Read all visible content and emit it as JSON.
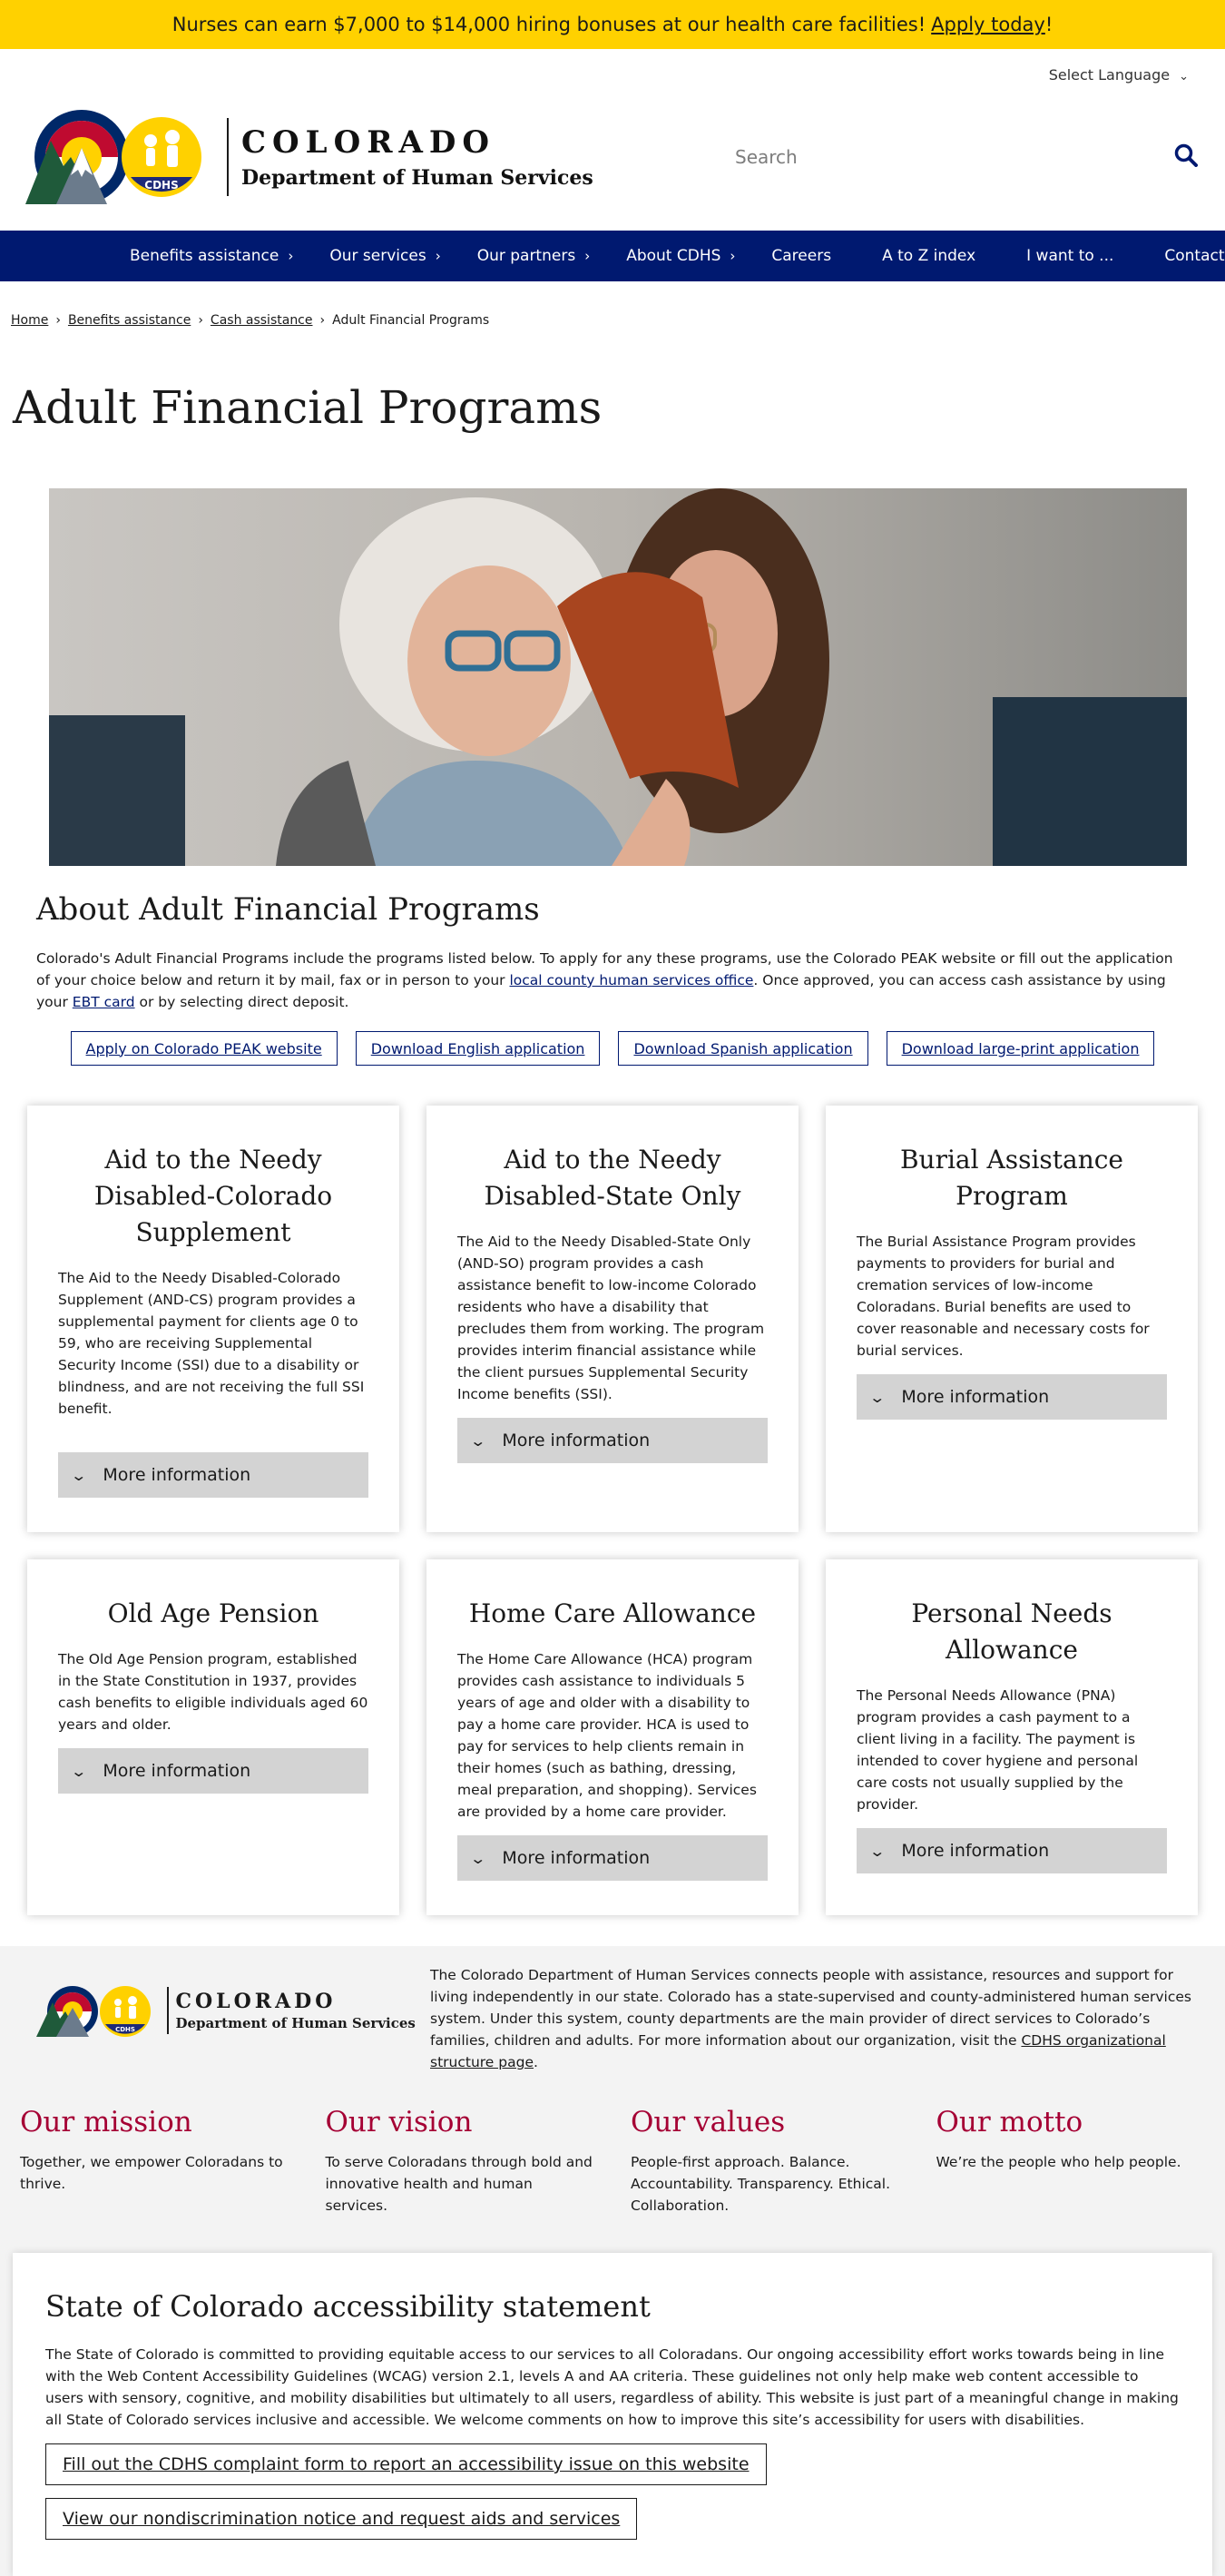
{
  "alert": {
    "text": "Nurses can earn $7,000 to $14,000 hiring bonuses at our health care facilities!",
    "link": "Apply today",
    "tail": "!"
  },
  "header": {
    "language": "Select Language",
    "logo_title": "COLORADO",
    "logo_subtitle": "Department of Human Services",
    "logo_badge": "CDHS",
    "search_placeholder": "Search"
  },
  "nav": {
    "items": [
      {
        "label": "Benefits assistance",
        "has_submenu": true
      },
      {
        "label": "Our services",
        "has_submenu": true
      },
      {
        "label": "Our partners",
        "has_submenu": true
      },
      {
        "label": "About CDHS",
        "has_submenu": true
      },
      {
        "label": "Careers",
        "has_submenu": false
      },
      {
        "label": "A to Z index",
        "has_submenu": false
      },
      {
        "label": "I want to ...",
        "has_submenu": false
      },
      {
        "label": "Contact us",
        "has_submenu": false
      }
    ]
  },
  "breadcrumb": {
    "home": "Home",
    "benefits": "Benefits assistance",
    "cash": "Cash assistance",
    "current": "Adult Financial Programs"
  },
  "page_title": "Adult Financial Programs",
  "about": {
    "heading": "About Adult Financial Programs",
    "text_1": "Colorado's Adult Financial Programs include the programs listed below. To apply for any these programs, use the Colorado PEAK website or fill out the application of your choice below and return it by mail, fax or in person to your ",
    "link_1": "local county human services office",
    "text_2": ". Once approved, you can access cash assistance by using your ",
    "link_2": "EBT card",
    "text_3": " or by selecting direct deposit.",
    "buttons": [
      "Apply on Colorado PEAK website",
      "Download English application",
      "Download Spanish application",
      "Download large-print application"
    ]
  },
  "cards": [
    {
      "title": "Aid to the Needy Disabled-Colorado Supplement",
      "body": "The Aid to the Needy Disabled-Colorado Supplement (AND-CS) program provides a supplemental payment for clients age 0 to 59, who are receiving Supplemental Security Income (SSI) due to a disability or blindness, and are not receiving the full SSI benefit.",
      "more": "More information"
    },
    {
      "title": "Aid to the Needy Disabled-State Only",
      "body": "The Aid to the Needy Disabled-State Only (AND-SO) program provides a cash assistance benefit to low-income Colorado residents who have a disability that precludes them from working. The program provides interim financial assistance while the client pursues Supplemental Security Income benefits (SSI).",
      "more": "More information"
    },
    {
      "title": "Burial Assistance Program",
      "body": "The Burial Assistance Program provides payments to providers for burial and cremation services of low-income Coloradans. Burial benefits are used to cover reasonable and necessary costs for burial services.",
      "more": "More information"
    },
    {
      "title": "Old Age Pension",
      "body": "The Old Age Pension program, established in the State Constitution in 1937, provides cash benefits to eligible individuals aged 60 years and older.",
      "more": "More information"
    },
    {
      "title": "Home Care Allowance",
      "body": "The Home Care Allowance (HCA) program provides cash assistance to individuals 5 years of age and older with a disability to pay a home care provider. HCA is used to pay for services to help clients remain in their homes (such as bathing, dressing, meal preparation, and shopping). Services are provided by a home care provider.",
      "more": "More information"
    },
    {
      "title": "Personal Needs Allowance",
      "body": "The Personal Needs Allowance (PNA) program provides a cash payment to a client living in a facility. The payment is intended to cover hygiene and personal care costs not usually supplied by the provider.",
      "more": "More information"
    }
  ],
  "footer": {
    "logo_title": "COLORADO",
    "logo_subtitle": "Department of Human Services",
    "logo_badge": "CDHS",
    "desc": "The Colorado Department of Human Services connects people with assistance, resources and support for living independently in our state. Colorado has a state-supervised and county-administered human services system. Under this system, county departments are the main provider of direct services to Colorado’s families, children and adults. For more information about our organization, visit the ",
    "desc_link": "CDHS organizational structure page",
    "desc_tail": ".",
    "mvv": [
      {
        "heading": "Our mission",
        "text": "Together, we empower Coloradans to thrive."
      },
      {
        "heading": "Our vision",
        "text": "To serve Coloradans through bold and innovative health and human services."
      },
      {
        "heading": "Our values",
        "text": "People-first approach. Balance. Accountability. Transparency. Ethical. Collaboration."
      },
      {
        "heading": "Our motto",
        "text": "We’re the people who help people."
      }
    ],
    "access_heading": "State of Colorado accessibility statement",
    "access_text": "The State of Colorado is committed to providing equitable access to our services to all Coloradans. Our ongoing accessibility effort works towards being in line with the Web Content Accessibility Guidelines (WCAG) version 2.1, levels A and AA criteria. These guidelines not only help make web content accessible to users with sensory, cognitive, and mobility disabilities but ultimately to all users, regardless of ability. This website is just part of a meaningful change in making all State of Colorado services inclusive and accessible. We welcome comments on how to improve this site’s accessibility for users with disabilities.",
    "access_btn_1": "Fill out the CDHS complaint form to report an accessibility issue on this website",
    "access_btn_2": "View our nondiscrimination notice and request aids and services"
  },
  "colors": {
    "alert_bg": "#ffd100",
    "nav_bg": "#001970",
    "brand_blue": "#001970",
    "mvv_red": "#a50034",
    "more_bg": "#d3d3d3"
  }
}
